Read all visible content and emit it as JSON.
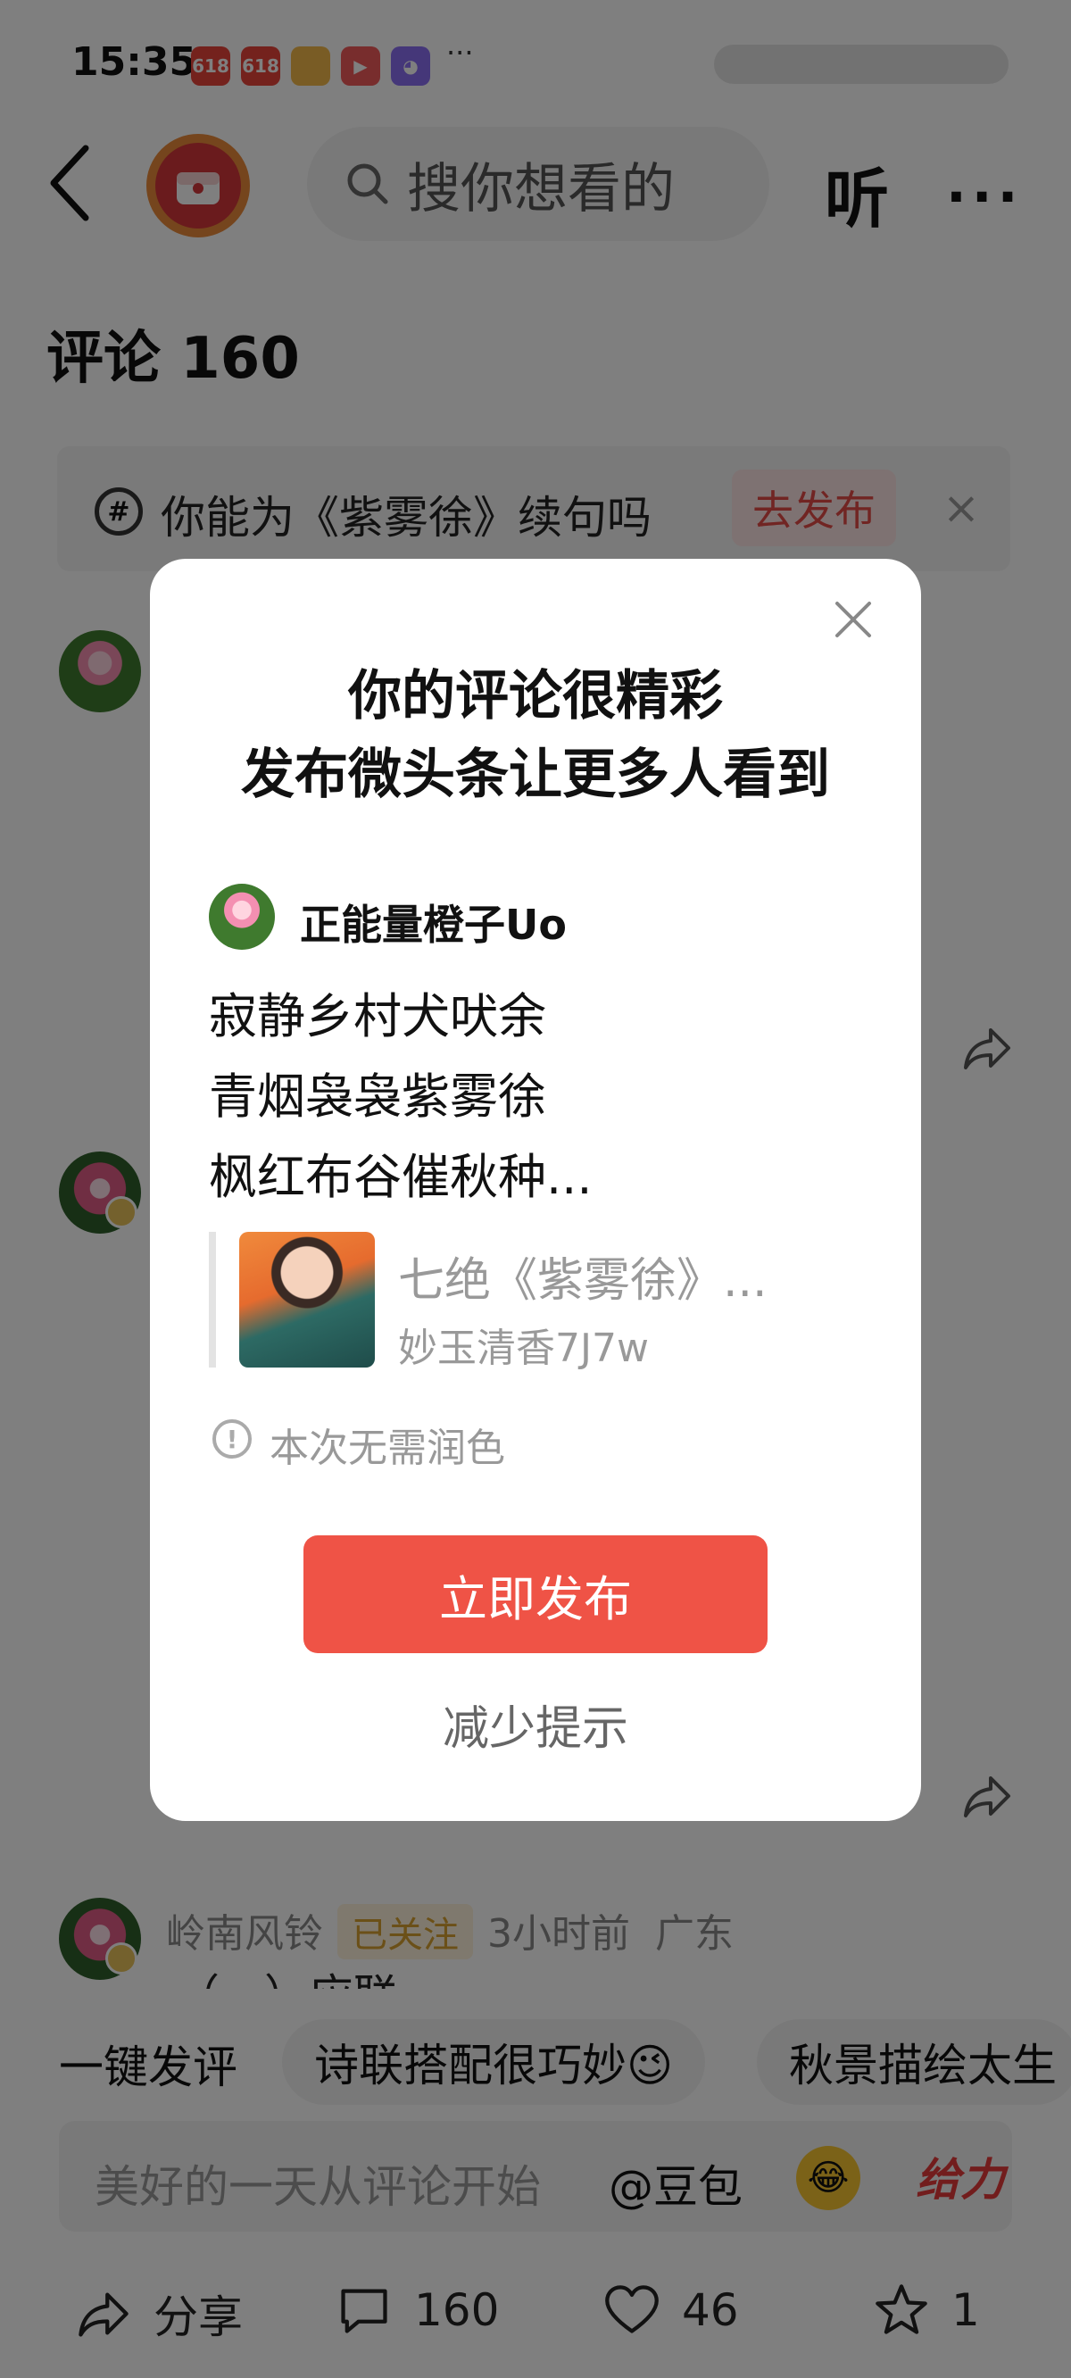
{
  "status_bar": {
    "time": "15:35",
    "more": "···"
  },
  "header": {
    "search_placeholder": "搜你想看的",
    "listen_label": "听",
    "more_label": "···"
  },
  "comments": {
    "title": "评论 160"
  },
  "topic_banner": {
    "text": "你能为《紫雾徐》续句吗",
    "action": "去发布",
    "close": "×"
  },
  "visible_comment": {
    "user": "岭南风铃",
    "follow_badge": "已关注",
    "time": "3小时前",
    "location": "广东",
    "content": "（一）应联"
  },
  "quick_replies": {
    "first": "一键发评",
    "chips": [
      "诗联搭配很巧妙😉",
      "秋景描绘太生"
    ]
  },
  "input": {
    "placeholder": "美好的一天从评论开始",
    "doubao": "@豆包",
    "emoji": "😂",
    "geili": "给力"
  },
  "bottom_bar": {
    "share": "分享",
    "comments": "160",
    "likes": "46",
    "stars": "1"
  },
  "modal": {
    "title_line1": "你的评论很精彩",
    "title_line2": "发布微头条让更多人看到",
    "username": "正能量橙子Uo",
    "lines": [
      "寂静乡村犬吠余",
      "青烟袅袅紫雾徐",
      "枫红布谷催秋种..."
    ],
    "quote_title": "七绝《紫雾徐》...",
    "quote_author": "妙玉清香7J7w",
    "notice": "本次无需润色",
    "publish_button": "立即发布",
    "reduce_hint": "减少提示"
  }
}
